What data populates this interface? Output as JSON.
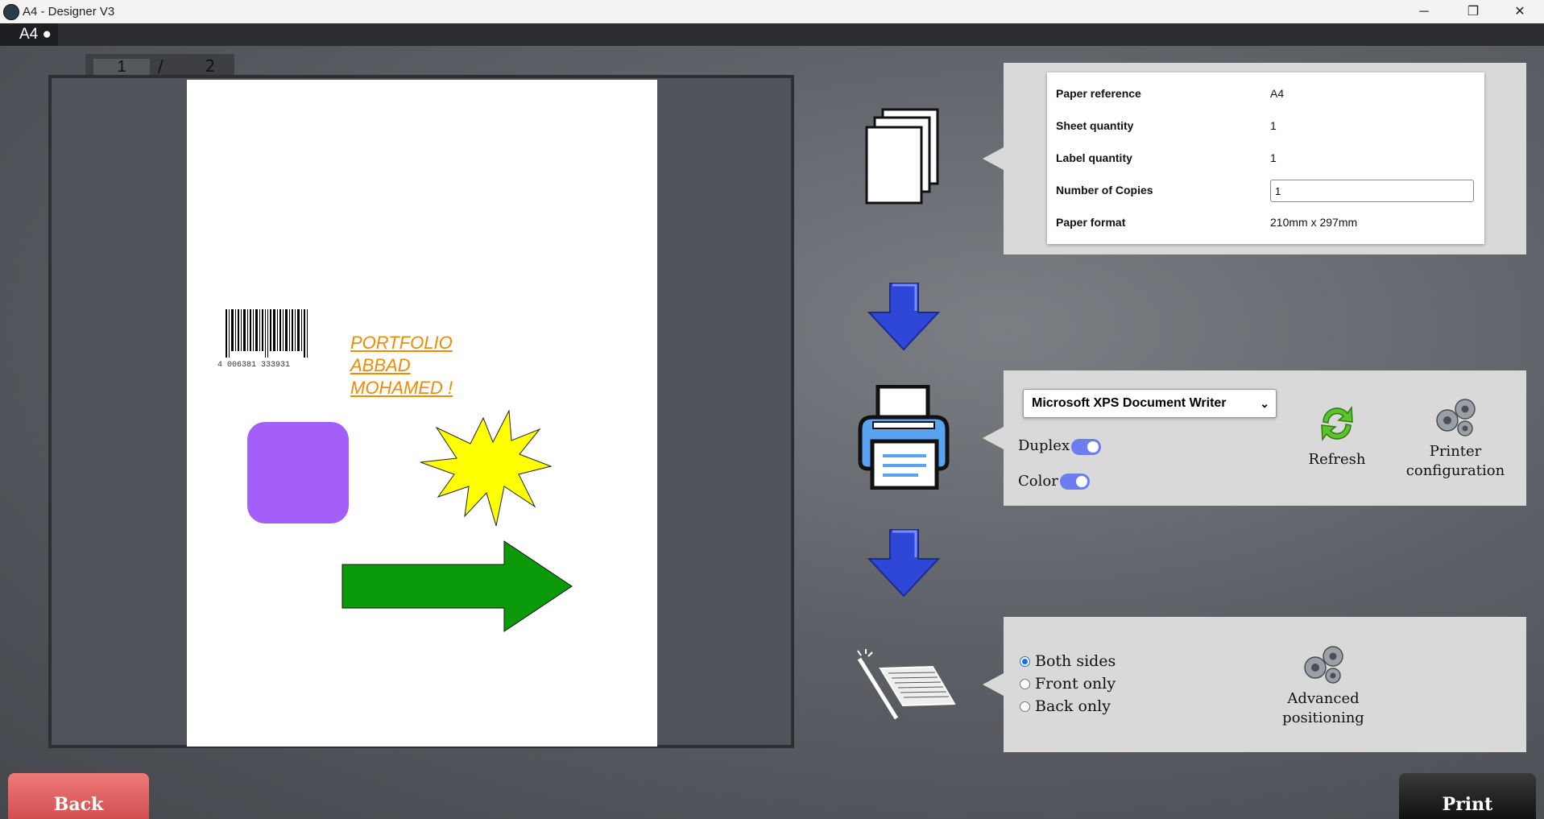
{
  "window": {
    "title": "A4 - Designer V3",
    "minimize_glyph": "─",
    "restore_glyph": "❐",
    "close_glyph": "✕"
  },
  "tab": {
    "label": "A4 ●"
  },
  "page_nav": {
    "current": "1",
    "separator": "/",
    "total": "2"
  },
  "canvas": {
    "text": [
      "PORTFOLIO",
      "ABBAD",
      "MOHAMED !"
    ],
    "barcode_digits": "4  006381  333931",
    "colors": {
      "text": "#f08a00",
      "square": "#a45ffa",
      "star": "#ffff00",
      "arrow": "#0a9a0a"
    }
  },
  "paper_info": {
    "rows": [
      {
        "label": "Paper reference",
        "value": "A4"
      },
      {
        "label": "Sheet quantity",
        "value": "1"
      },
      {
        "label": "Label quantity",
        "value": "1"
      },
      {
        "label": "Number of Copies",
        "value": "1"
      },
      {
        "label": "Paper format",
        "value": "210mm x 297mm"
      }
    ]
  },
  "printer": {
    "selected": "Microsoft XPS Document Writer",
    "duplex_label": "Duplex",
    "duplex_on": true,
    "color_label": "Color",
    "color_on": true,
    "refresh_label": "Refresh",
    "config_label_1": "Printer",
    "config_label_2": "configuration"
  },
  "positioning": {
    "options": [
      "Both sides",
      "Front only",
      "Back only"
    ],
    "selected": "Both sides",
    "advanced_label_1": "Advanced",
    "advanced_label_2": "positioning"
  },
  "icons": [
    "paper-stack-icon",
    "down-arrow-icon",
    "printer-icon",
    "sheet-feed-icon",
    "refresh-icon",
    "gears-icon"
  ],
  "buttons": {
    "back": "Back",
    "print": "Print"
  }
}
